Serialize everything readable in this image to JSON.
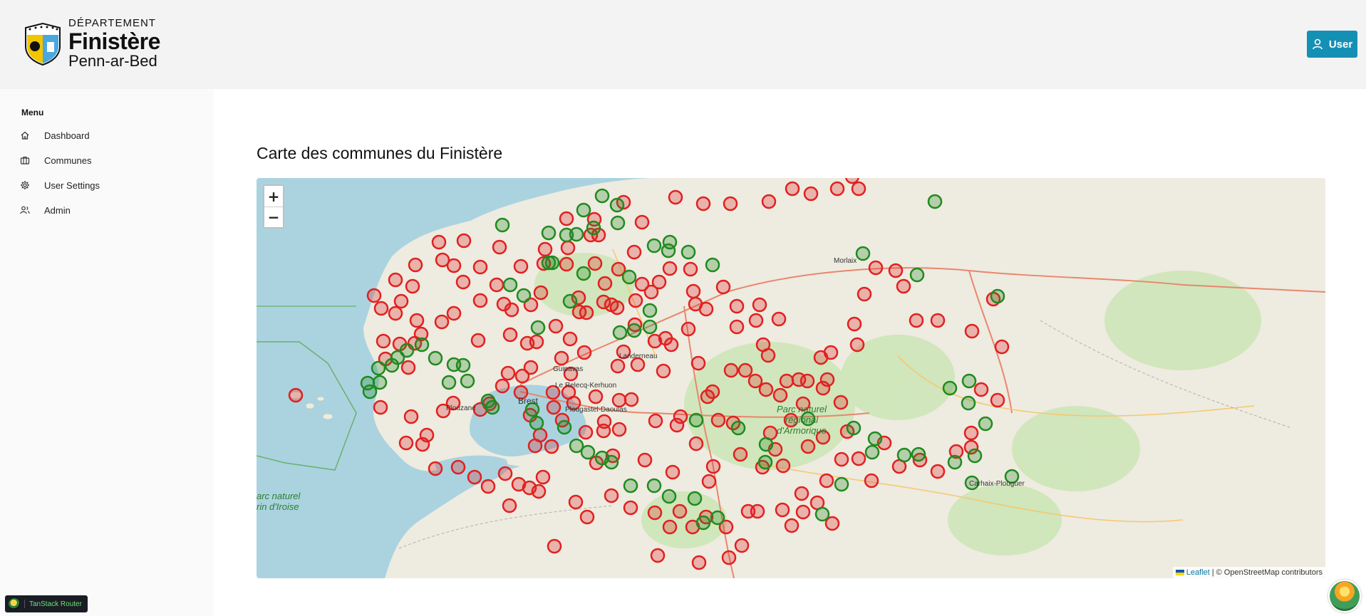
{
  "header": {
    "logo": {
      "line1": "DÉPARTEMENT",
      "line2": "Finistère",
      "line3": "Penn-ar-Bed"
    },
    "user_button": "User"
  },
  "sidebar": {
    "menu_title": "Menu",
    "items": [
      {
        "label": "Dashboard",
        "icon": "home-icon"
      },
      {
        "label": "Communes",
        "icon": "briefcase-icon"
      },
      {
        "label": "User Settings",
        "icon": "gear-icon"
      },
      {
        "label": "Admin",
        "icon": "users-icon"
      }
    ],
    "devtools_label": "TanStack Router"
  },
  "main": {
    "title": "Carte des communes du Finistère",
    "map": {
      "zoom_in": "+",
      "zoom_out": "−",
      "attribution_link": "Leaflet",
      "attribution_text": "| © OpenStreetMap contributors",
      "places": [
        "Morlaix",
        "Landerneau",
        "Guipavas",
        "Le Relecq-Kerhuon",
        "Brest",
        "Plouzané",
        "Plougastel-Daoulas",
        "Carhaix-Plouguer"
      ],
      "park_label": "Parc naturel régional d'Armorique",
      "iroise_label": "arc naturel rin d'Iroise",
      "colors": {
        "red": "#e02020",
        "green": "#1f8a1f"
      }
    }
  }
}
